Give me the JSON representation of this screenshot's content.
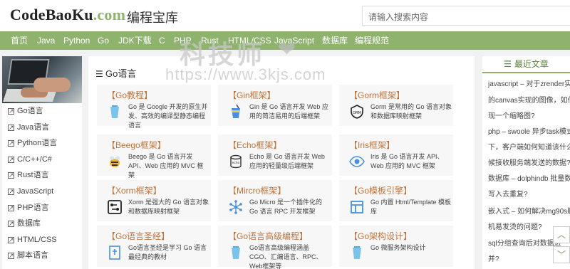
{
  "header": {
    "logo_main": "CodeBaoKu",
    "logo_suffix": ".com",
    "logo_subtitle": "编程宝库",
    "search_placeholder": "请输入搜索内容"
  },
  "nav": {
    "items": [
      "首页",
      "Java",
      "Python",
      "Go",
      "JDK下载",
      "C",
      "PHP",
      "Rust",
      "HTML/CSS",
      "JavaScript",
      "数据库",
      "编程规范"
    ]
  },
  "watermark": {
    "text": "科技师",
    "url": "https://www.3kjs.com"
  },
  "sidebar": {
    "items": [
      "Go语言",
      "Java语言",
      "Python语言",
      "C/C++/C#",
      "Rust语言",
      "JavaScript",
      "PHP语言",
      "数据库",
      "HTML/CSS",
      "脚本语言"
    ]
  },
  "main": {
    "section_title": "Go语言",
    "cards": [
      {
        "title": "【Go教程】",
        "desc": "Go 是 Google 开发的原生并发、高效的编译型静态编程语言",
        "icon": "cup-icon"
      },
      {
        "title": "【Gin框架】",
        "desc": "Gin 是 Go 语言开发 Web 应用的简洁易用的后端框架",
        "icon": "drink-icon"
      },
      {
        "title": "【Gorm框架】",
        "desc": "Gorm 是常用的 Go 语言对象和数据库映射框架",
        "icon": "orm-icon"
      },
      {
        "title": "【Beego框架】",
        "desc": "Beego 是 Go 语言开发 API、Web 应用的 MVC 框架",
        "icon": "bee-icon"
      },
      {
        "title": "【Echo框架】",
        "desc": "Echo 是 Go 语言开发 Web 应用的轻量级后端框架",
        "icon": "echo-icon"
      },
      {
        "title": "【Iris框架】",
        "desc": "Iris 是 Go 语言开发 API、Web 应用的 MVC 框架",
        "icon": "eye-icon"
      },
      {
        "title": "【Xorm框架】",
        "desc": "Xorm 是强大的 Go 语言对象和数据库映射框架",
        "icon": "nodes-square-icon"
      },
      {
        "title": "【Mircro框架】",
        "desc": "Go Micro 是一个插件化的 Go 语言 RPC 开发框架",
        "icon": "network-icon"
      },
      {
        "title": "【Go模板引擎】",
        "desc": "Go 内置 Html/Template 模板库",
        "icon": "template-icon"
      },
      {
        "title": "【Go语言圣经】",
        "desc": "Go语言圣经是学习 Go 语言最经典的教材",
        "icon": "book-icon"
      },
      {
        "title": "【Go语言高级编程】",
        "desc": "Go语言高级编程涵盖 CGO、汇编语言、RPC、Web框架等",
        "icon": "cup-icon"
      },
      {
        "title": "【Go架构设计】",
        "desc": "Go 微服务架构设计",
        "icon": "cup-icon"
      }
    ]
  },
  "right": {
    "title": "最近文章",
    "lines": [
      "javascript – 对于zrender实现",
      "的canvas实现的图像，如何受",
      "现一个缩略图?",
      "php – swoole 异步task模式",
      "下，客户端如何知道该什么时",
      "候接收服务端发送的数据?",
      "数据库 – dolphindb 批量数据",
      "写入去重复?",
      "嵌入式 – 如何解决mg90s舵",
      "机易发烫的问题?",
      "sql分组查询后对数据进",
      "并?"
    ]
  },
  "controls": {
    "up_glyph": "︿",
    "down_glyph": "﹀"
  },
  "colors": {
    "accent": "#8fb36e",
    "card_title": "#c0733a",
    "icon_blue": "#6bb8e6"
  }
}
